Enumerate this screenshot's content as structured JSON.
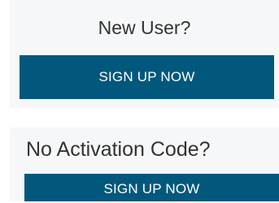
{
  "new_user": {
    "heading": "New User?",
    "button_label": "SIGN UP NOW"
  },
  "no_activation": {
    "heading": "No Activation Code?",
    "button_label": "SIGN UP NOW"
  },
  "colors": {
    "button_background": "#02587c",
    "button_text": "#ffffff",
    "panel_background": "#f6f7f8",
    "heading_text": "#333333"
  }
}
